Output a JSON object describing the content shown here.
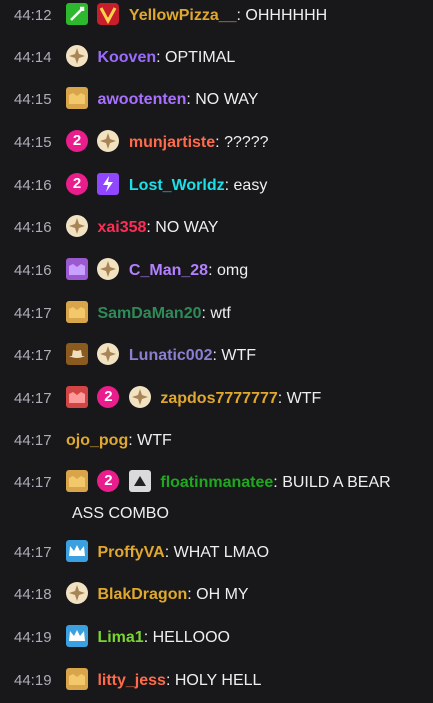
{
  "messages": [
    {
      "time": "44:12",
      "user": "YellowPizza__",
      "color": "#e0a82e",
      "text": "OHHHHHH"
    },
    {
      "time": "44:14",
      "user": "Kooven",
      "color": "#9b6bff",
      "text": "OPTIMAL"
    },
    {
      "time": "44:15",
      "user": "awootenten",
      "color": "#a970ff",
      "text": "NO WAY"
    },
    {
      "time": "44:15",
      "user": "munjartiste",
      "color": "#ff6b4a",
      "text": "?????"
    },
    {
      "time": "44:16",
      "user": "Lost_Worldz",
      "color": "#1be0e8",
      "text": "easy"
    },
    {
      "time": "44:16",
      "user": "xai358",
      "color": "#ff2d55",
      "text": "NO WAY"
    },
    {
      "time": "44:16",
      "user": "C_Man_28",
      "color": "#b380ff",
      "text": "omg"
    },
    {
      "time": "44:17",
      "user": "SamDaMan20",
      "color": "#2e8b57",
      "text": "wtf"
    },
    {
      "time": "44:17",
      "user": "Lunatic002",
      "color": "#8a7fd0",
      "text": "WTF"
    },
    {
      "time": "44:17",
      "user": "zapdos7777777",
      "color": "#e0a82e",
      "text": "WTF"
    },
    {
      "time": "44:17",
      "user": "ojo_pog",
      "color": "#e0a82e",
      "text": "WTF"
    },
    {
      "time": "44:17",
      "user": "floatinmanatee",
      "color": "#1fa81f",
      "text": "BUILD A BEAR",
      "text2": "ASS COMBO"
    },
    {
      "time": "44:17",
      "user": "ProffyVA",
      "color": "#e0a82e",
      "text": "WHAT LMAO"
    },
    {
      "time": "44:18",
      "user": "BlakDragon",
      "color": "#e0a82e",
      "text": "OH MY"
    },
    {
      "time": "44:19",
      "user": "Lima1",
      "color": "#7ad62e",
      "text": "HELLOOO"
    },
    {
      "time": "44:19",
      "user": "litty_jess",
      "color": "#ff6b4a",
      "text": "HOLY HELL"
    }
  ],
  "sub_badge_number": "2",
  "separator": ":"
}
